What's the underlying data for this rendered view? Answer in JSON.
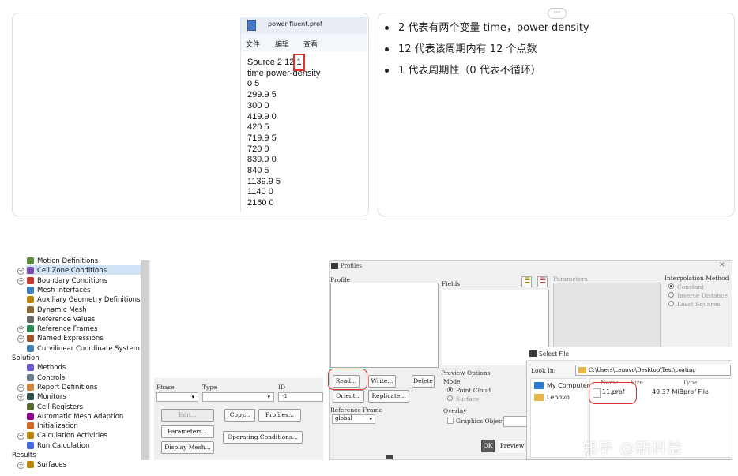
{
  "notepad": {
    "title": "power-fluent.prof",
    "menu": [
      "文件",
      "编辑",
      "查看"
    ],
    "lines": [
      "Source 2 12 1",
      "time power-density",
      "0 5",
      "299.9 5",
      "300 0",
      "419.9 0",
      "420 5",
      "719.9 5",
      "720 0",
      "839.9 0",
      "840 5",
      "1139.9 5",
      "1140 0",
      "2160 0"
    ]
  },
  "card_menu": "···",
  "notes": [
    "2 代表有两个变量 time，power-density",
    "12 代表该周期内有 12 个点数",
    "1 代表周期性（0 代表不循环）"
  ],
  "tree": {
    "items": [
      {
        "label": "Motion Definitions",
        "expander": false,
        "icon": "motion-icon"
      },
      {
        "label": "Cell Zone Conditions",
        "expander": true,
        "icon": "grid-icon"
      },
      {
        "label": "Boundary Conditions",
        "expander": true,
        "icon": "boundary-icon"
      },
      {
        "label": "Mesh Interfaces",
        "expander": false,
        "icon": "interface-icon"
      },
      {
        "label": "Auxiliary Geometry Definitions",
        "expander": false,
        "icon": "geometry-icon"
      },
      {
        "label": "Dynamic Mesh",
        "expander": false,
        "icon": "dynamic-mesh-icon"
      },
      {
        "label": "Reference Values",
        "expander": false,
        "icon": "reference-icon"
      },
      {
        "label": "Reference Frames",
        "expander": true,
        "icon": "frames-icon"
      },
      {
        "label": "Named Expressions",
        "expander": true,
        "icon": "function-icon"
      },
      {
        "label": "Curvilinear Coordinate System",
        "expander": false,
        "icon": "coordinate-icon"
      },
      {
        "label": "Solution",
        "section": true
      },
      {
        "label": "Methods",
        "expander": false,
        "icon": "methods-icon"
      },
      {
        "label": "Controls",
        "expander": false,
        "icon": "controls-icon"
      },
      {
        "label": "Report Definitions",
        "expander": true,
        "icon": "report-icon"
      },
      {
        "label": "Monitors",
        "expander": true,
        "icon": "monitor-icon"
      },
      {
        "label": "Cell Registers",
        "expander": false,
        "icon": "register-icon"
      },
      {
        "label": "Automatic Mesh Adaption",
        "expander": false,
        "icon": "adaption-icon"
      },
      {
        "label": "Initialization",
        "expander": false,
        "icon": "initialization-icon"
      },
      {
        "label": "Calculation Activities",
        "expander": true,
        "icon": "activities-icon"
      },
      {
        "label": "Run Calculation",
        "expander": false,
        "icon": "run-icon"
      },
      {
        "label": "Results",
        "section": true
      },
      {
        "label": "Surfaces",
        "expander": true,
        "icon": "surfaces-icon"
      }
    ]
  },
  "cellzone": {
    "phase_label": "Phase",
    "type_label": "Type",
    "id_label": "ID",
    "id_value": "-1",
    "buttons": {
      "edit": "Edit...",
      "copy": "Copy...",
      "profiles": "Profiles...",
      "parameters": "Parameters...",
      "operating": "Operating Conditions...",
      "display_mesh": "Display Mesh..."
    }
  },
  "profiles": {
    "title": "Profiles",
    "profile_label": "Profile",
    "fields_label": "Fields",
    "parameters_label": "Parameters",
    "interp_label": "Interpolation Method",
    "interp_options": [
      "Constant",
      "Inverse Distance",
      "Least Squares"
    ],
    "buttons": {
      "read": "Read...",
      "write": "Write...",
      "delete": "Delete",
      "orient": "Orient...",
      "replicate": "Replicate...",
      "ok": "OK",
      "preview": "Preview"
    },
    "reference_frame_label": "Reference Frame",
    "reference_frame_value": "global",
    "preview_options_label": "Preview Options",
    "mode_label": "Mode",
    "mode_options": [
      "Point Cloud",
      "Surface"
    ],
    "overlay_label": "Overlay",
    "graphics_object_label": "Graphics Object"
  },
  "select_file": {
    "title": "Select File",
    "look_in_label": "Look In:",
    "path": "C:\\Users\\Lenovo\\Desktop\\Test\\coating",
    "places": [
      "My Computer",
      "Lenovo"
    ],
    "columns": [
      "Name",
      "Size",
      "Type"
    ],
    "files": [
      {
        "name": "11.prof",
        "size": "49.37 MiB",
        "type": "prof File"
      }
    ]
  },
  "watermark": "知乎 @新科益",
  "colors": {
    "highlight_red": "#e03030",
    "selection": "#cfe3f7"
  }
}
